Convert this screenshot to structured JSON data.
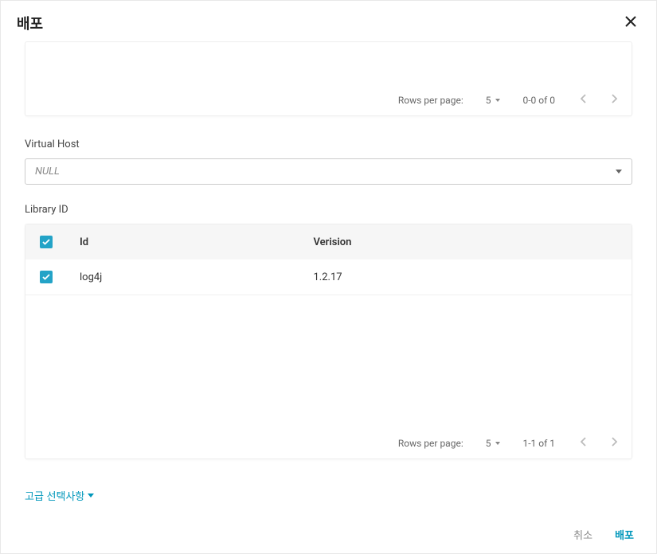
{
  "dialog": {
    "title": "배포"
  },
  "emptyTable": {
    "pagination": {
      "rowsPerPageLabel": "Rows per page:",
      "pageSize": "5",
      "range": "0-0 of 0"
    }
  },
  "virtualHost": {
    "label": "Virtual Host",
    "value": "NULL"
  },
  "libraryId": {
    "label": "Library ID",
    "columns": {
      "id": "Id",
      "version": "Verision"
    },
    "rows": [
      {
        "id": "log4j",
        "version": "1.2.17"
      }
    ],
    "pagination": {
      "rowsPerPageLabel": "Rows per page:",
      "pageSize": "5",
      "range": "1-1 of 1"
    }
  },
  "advanced": {
    "label": "고급 선택사항"
  },
  "footer": {
    "cancel": "취소",
    "deploy": "배포"
  }
}
